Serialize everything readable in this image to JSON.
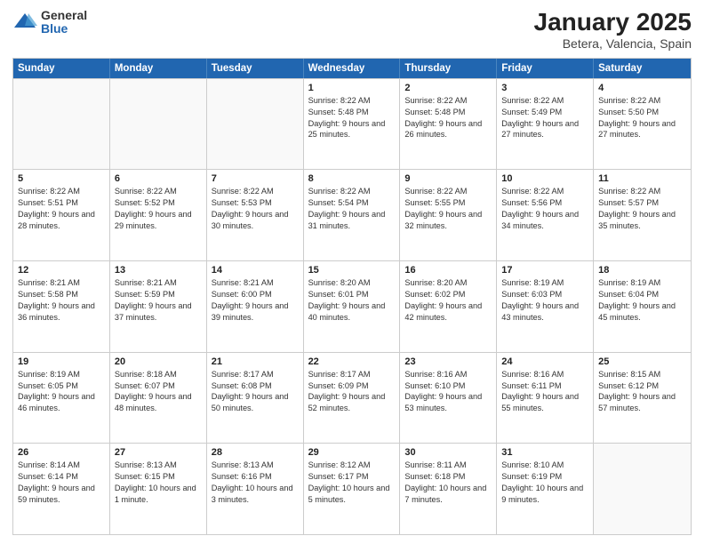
{
  "logo": {
    "general": "General",
    "blue": "Blue"
  },
  "header": {
    "title": "January 2025",
    "subtitle": "Betera, Valencia, Spain"
  },
  "weekdays": [
    "Sunday",
    "Monday",
    "Tuesday",
    "Wednesday",
    "Thursday",
    "Friday",
    "Saturday"
  ],
  "weeks": [
    [
      {
        "day": "",
        "sunrise": "",
        "sunset": "",
        "daylight": ""
      },
      {
        "day": "",
        "sunrise": "",
        "sunset": "",
        "daylight": ""
      },
      {
        "day": "",
        "sunrise": "",
        "sunset": "",
        "daylight": ""
      },
      {
        "day": "1",
        "sunrise": "Sunrise: 8:22 AM",
        "sunset": "Sunset: 5:48 PM",
        "daylight": "Daylight: 9 hours and 25 minutes."
      },
      {
        "day": "2",
        "sunrise": "Sunrise: 8:22 AM",
        "sunset": "Sunset: 5:48 PM",
        "daylight": "Daylight: 9 hours and 26 minutes."
      },
      {
        "day": "3",
        "sunrise": "Sunrise: 8:22 AM",
        "sunset": "Sunset: 5:49 PM",
        "daylight": "Daylight: 9 hours and 27 minutes."
      },
      {
        "day": "4",
        "sunrise": "Sunrise: 8:22 AM",
        "sunset": "Sunset: 5:50 PM",
        "daylight": "Daylight: 9 hours and 27 minutes."
      }
    ],
    [
      {
        "day": "5",
        "sunrise": "Sunrise: 8:22 AM",
        "sunset": "Sunset: 5:51 PM",
        "daylight": "Daylight: 9 hours and 28 minutes."
      },
      {
        "day": "6",
        "sunrise": "Sunrise: 8:22 AM",
        "sunset": "Sunset: 5:52 PM",
        "daylight": "Daylight: 9 hours and 29 minutes."
      },
      {
        "day": "7",
        "sunrise": "Sunrise: 8:22 AM",
        "sunset": "Sunset: 5:53 PM",
        "daylight": "Daylight: 9 hours and 30 minutes."
      },
      {
        "day": "8",
        "sunrise": "Sunrise: 8:22 AM",
        "sunset": "Sunset: 5:54 PM",
        "daylight": "Daylight: 9 hours and 31 minutes."
      },
      {
        "day": "9",
        "sunrise": "Sunrise: 8:22 AM",
        "sunset": "Sunset: 5:55 PM",
        "daylight": "Daylight: 9 hours and 32 minutes."
      },
      {
        "day": "10",
        "sunrise": "Sunrise: 8:22 AM",
        "sunset": "Sunset: 5:56 PM",
        "daylight": "Daylight: 9 hours and 34 minutes."
      },
      {
        "day": "11",
        "sunrise": "Sunrise: 8:22 AM",
        "sunset": "Sunset: 5:57 PM",
        "daylight": "Daylight: 9 hours and 35 minutes."
      }
    ],
    [
      {
        "day": "12",
        "sunrise": "Sunrise: 8:21 AM",
        "sunset": "Sunset: 5:58 PM",
        "daylight": "Daylight: 9 hours and 36 minutes."
      },
      {
        "day": "13",
        "sunrise": "Sunrise: 8:21 AM",
        "sunset": "Sunset: 5:59 PM",
        "daylight": "Daylight: 9 hours and 37 minutes."
      },
      {
        "day": "14",
        "sunrise": "Sunrise: 8:21 AM",
        "sunset": "Sunset: 6:00 PM",
        "daylight": "Daylight: 9 hours and 39 minutes."
      },
      {
        "day": "15",
        "sunrise": "Sunrise: 8:20 AM",
        "sunset": "Sunset: 6:01 PM",
        "daylight": "Daylight: 9 hours and 40 minutes."
      },
      {
        "day": "16",
        "sunrise": "Sunrise: 8:20 AM",
        "sunset": "Sunset: 6:02 PM",
        "daylight": "Daylight: 9 hours and 42 minutes."
      },
      {
        "day": "17",
        "sunrise": "Sunrise: 8:19 AM",
        "sunset": "Sunset: 6:03 PM",
        "daylight": "Daylight: 9 hours and 43 minutes."
      },
      {
        "day": "18",
        "sunrise": "Sunrise: 8:19 AM",
        "sunset": "Sunset: 6:04 PM",
        "daylight": "Daylight: 9 hours and 45 minutes."
      }
    ],
    [
      {
        "day": "19",
        "sunrise": "Sunrise: 8:19 AM",
        "sunset": "Sunset: 6:05 PM",
        "daylight": "Daylight: 9 hours and 46 minutes."
      },
      {
        "day": "20",
        "sunrise": "Sunrise: 8:18 AM",
        "sunset": "Sunset: 6:07 PM",
        "daylight": "Daylight: 9 hours and 48 minutes."
      },
      {
        "day": "21",
        "sunrise": "Sunrise: 8:17 AM",
        "sunset": "Sunset: 6:08 PM",
        "daylight": "Daylight: 9 hours and 50 minutes."
      },
      {
        "day": "22",
        "sunrise": "Sunrise: 8:17 AM",
        "sunset": "Sunset: 6:09 PM",
        "daylight": "Daylight: 9 hours and 52 minutes."
      },
      {
        "day": "23",
        "sunrise": "Sunrise: 8:16 AM",
        "sunset": "Sunset: 6:10 PM",
        "daylight": "Daylight: 9 hours and 53 minutes."
      },
      {
        "day": "24",
        "sunrise": "Sunrise: 8:16 AM",
        "sunset": "Sunset: 6:11 PM",
        "daylight": "Daylight: 9 hours and 55 minutes."
      },
      {
        "day": "25",
        "sunrise": "Sunrise: 8:15 AM",
        "sunset": "Sunset: 6:12 PM",
        "daylight": "Daylight: 9 hours and 57 minutes."
      }
    ],
    [
      {
        "day": "26",
        "sunrise": "Sunrise: 8:14 AM",
        "sunset": "Sunset: 6:14 PM",
        "daylight": "Daylight: 9 hours and 59 minutes."
      },
      {
        "day": "27",
        "sunrise": "Sunrise: 8:13 AM",
        "sunset": "Sunset: 6:15 PM",
        "daylight": "Daylight: 10 hours and 1 minute."
      },
      {
        "day": "28",
        "sunrise": "Sunrise: 8:13 AM",
        "sunset": "Sunset: 6:16 PM",
        "daylight": "Daylight: 10 hours and 3 minutes."
      },
      {
        "day": "29",
        "sunrise": "Sunrise: 8:12 AM",
        "sunset": "Sunset: 6:17 PM",
        "daylight": "Daylight: 10 hours and 5 minutes."
      },
      {
        "day": "30",
        "sunrise": "Sunrise: 8:11 AM",
        "sunset": "Sunset: 6:18 PM",
        "daylight": "Daylight: 10 hours and 7 minutes."
      },
      {
        "day": "31",
        "sunrise": "Sunrise: 8:10 AM",
        "sunset": "Sunset: 6:19 PM",
        "daylight": "Daylight: 10 hours and 9 minutes."
      },
      {
        "day": "",
        "sunrise": "",
        "sunset": "",
        "daylight": ""
      }
    ]
  ]
}
